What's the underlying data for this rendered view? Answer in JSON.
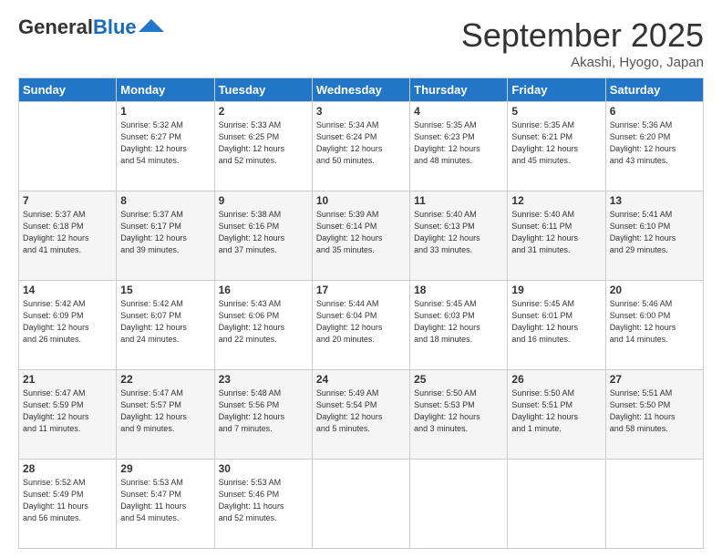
{
  "header": {
    "logo_general": "General",
    "logo_blue": "Blue",
    "month_title": "September 2025",
    "location": "Akashi, Hyogo, Japan"
  },
  "days_of_week": [
    "Sunday",
    "Monday",
    "Tuesday",
    "Wednesday",
    "Thursday",
    "Friday",
    "Saturday"
  ],
  "weeks": [
    [
      {
        "day": "",
        "info": ""
      },
      {
        "day": "1",
        "info": "Sunrise: 5:32 AM\nSunset: 6:27 PM\nDaylight: 12 hours\nand 54 minutes."
      },
      {
        "day": "2",
        "info": "Sunrise: 5:33 AM\nSunset: 6:25 PM\nDaylight: 12 hours\nand 52 minutes."
      },
      {
        "day": "3",
        "info": "Sunrise: 5:34 AM\nSunset: 6:24 PM\nDaylight: 12 hours\nand 50 minutes."
      },
      {
        "day": "4",
        "info": "Sunrise: 5:35 AM\nSunset: 6:23 PM\nDaylight: 12 hours\nand 48 minutes."
      },
      {
        "day": "5",
        "info": "Sunrise: 5:35 AM\nSunset: 6:21 PM\nDaylight: 12 hours\nand 45 minutes."
      },
      {
        "day": "6",
        "info": "Sunrise: 5:36 AM\nSunset: 6:20 PM\nDaylight: 12 hours\nand 43 minutes."
      }
    ],
    [
      {
        "day": "7",
        "info": "Sunrise: 5:37 AM\nSunset: 6:18 PM\nDaylight: 12 hours\nand 41 minutes."
      },
      {
        "day": "8",
        "info": "Sunrise: 5:37 AM\nSunset: 6:17 PM\nDaylight: 12 hours\nand 39 minutes."
      },
      {
        "day": "9",
        "info": "Sunrise: 5:38 AM\nSunset: 6:16 PM\nDaylight: 12 hours\nand 37 minutes."
      },
      {
        "day": "10",
        "info": "Sunrise: 5:39 AM\nSunset: 6:14 PM\nDaylight: 12 hours\nand 35 minutes."
      },
      {
        "day": "11",
        "info": "Sunrise: 5:40 AM\nSunset: 6:13 PM\nDaylight: 12 hours\nand 33 minutes."
      },
      {
        "day": "12",
        "info": "Sunrise: 5:40 AM\nSunset: 6:11 PM\nDaylight: 12 hours\nand 31 minutes."
      },
      {
        "day": "13",
        "info": "Sunrise: 5:41 AM\nSunset: 6:10 PM\nDaylight: 12 hours\nand 29 minutes."
      }
    ],
    [
      {
        "day": "14",
        "info": "Sunrise: 5:42 AM\nSunset: 6:09 PM\nDaylight: 12 hours\nand 26 minutes."
      },
      {
        "day": "15",
        "info": "Sunrise: 5:42 AM\nSunset: 6:07 PM\nDaylight: 12 hours\nand 24 minutes."
      },
      {
        "day": "16",
        "info": "Sunrise: 5:43 AM\nSunset: 6:06 PM\nDaylight: 12 hours\nand 22 minutes."
      },
      {
        "day": "17",
        "info": "Sunrise: 5:44 AM\nSunset: 6:04 PM\nDaylight: 12 hours\nand 20 minutes."
      },
      {
        "day": "18",
        "info": "Sunrise: 5:45 AM\nSunset: 6:03 PM\nDaylight: 12 hours\nand 18 minutes."
      },
      {
        "day": "19",
        "info": "Sunrise: 5:45 AM\nSunset: 6:01 PM\nDaylight: 12 hours\nand 16 minutes."
      },
      {
        "day": "20",
        "info": "Sunrise: 5:46 AM\nSunset: 6:00 PM\nDaylight: 12 hours\nand 14 minutes."
      }
    ],
    [
      {
        "day": "21",
        "info": "Sunrise: 5:47 AM\nSunset: 5:59 PM\nDaylight: 12 hours\nand 11 minutes."
      },
      {
        "day": "22",
        "info": "Sunrise: 5:47 AM\nSunset: 5:57 PM\nDaylight: 12 hours\nand 9 minutes."
      },
      {
        "day": "23",
        "info": "Sunrise: 5:48 AM\nSunset: 5:56 PM\nDaylight: 12 hours\nand 7 minutes."
      },
      {
        "day": "24",
        "info": "Sunrise: 5:49 AM\nSunset: 5:54 PM\nDaylight: 12 hours\nand 5 minutes."
      },
      {
        "day": "25",
        "info": "Sunrise: 5:50 AM\nSunset: 5:53 PM\nDaylight: 12 hours\nand 3 minutes."
      },
      {
        "day": "26",
        "info": "Sunrise: 5:50 AM\nSunset: 5:51 PM\nDaylight: 12 hours\nand 1 minute."
      },
      {
        "day": "27",
        "info": "Sunrise: 5:51 AM\nSunset: 5:50 PM\nDaylight: 11 hours\nand 58 minutes."
      }
    ],
    [
      {
        "day": "28",
        "info": "Sunrise: 5:52 AM\nSunset: 5:49 PM\nDaylight: 11 hours\nand 56 minutes."
      },
      {
        "day": "29",
        "info": "Sunrise: 5:53 AM\nSunset: 5:47 PM\nDaylight: 11 hours\nand 54 minutes."
      },
      {
        "day": "30",
        "info": "Sunrise: 5:53 AM\nSunset: 5:46 PM\nDaylight: 11 hours\nand 52 minutes."
      },
      {
        "day": "",
        "info": ""
      },
      {
        "day": "",
        "info": ""
      },
      {
        "day": "",
        "info": ""
      },
      {
        "day": "",
        "info": ""
      }
    ]
  ]
}
